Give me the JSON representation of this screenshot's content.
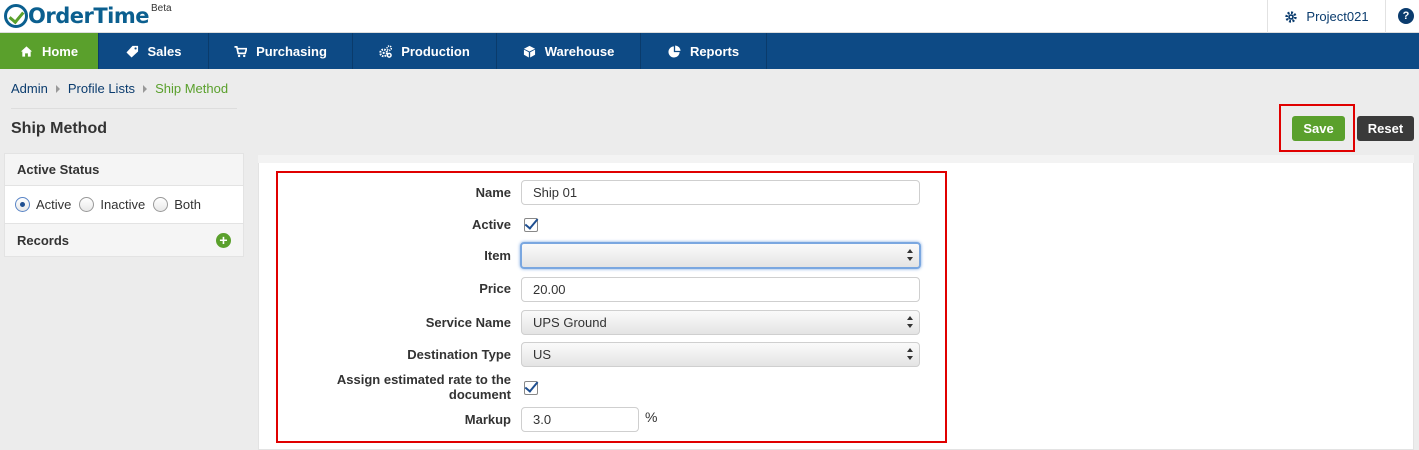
{
  "app": {
    "logo_text": "OrderTime",
    "logo_beta": "Beta",
    "project": "Project021",
    "help_glyph": "?"
  },
  "nav": [
    {
      "label": "Home",
      "icon": "home-icon",
      "active": true
    },
    {
      "label": "Sales",
      "icon": "tag-icon",
      "active": false
    },
    {
      "label": "Purchasing",
      "icon": "cart-icon",
      "active": false
    },
    {
      "label": "Production",
      "icon": "gears-icon",
      "active": false
    },
    {
      "label": "Warehouse",
      "icon": "box-icon",
      "active": false
    },
    {
      "label": "Reports",
      "icon": "pie-chart-icon",
      "active": false
    }
  ],
  "breadcrumb": [
    "Admin",
    "Profile Lists",
    "Ship Method"
  ],
  "page_title": "Ship Method",
  "toolbar": {
    "save_label": "Save",
    "reset_label": "Reset"
  },
  "sidebar": {
    "status_header": "Active Status",
    "status_options": [
      "Active",
      "Inactive",
      "Both"
    ],
    "status_selected": "Active",
    "records_header": "Records",
    "add_glyph": "+"
  },
  "form": {
    "name_label": "Name",
    "name_value": "Ship 01",
    "active_label": "Active",
    "active_checked": true,
    "item_label": "Item",
    "item_value": "",
    "price_label": "Price",
    "price_value": "20.00",
    "service_label": "Service Name",
    "service_value": "UPS Ground",
    "destination_label": "Destination Type",
    "destination_value": "US",
    "assign_label": "Assign estimated rate to the document",
    "assign_checked": true,
    "markup_label": "Markup",
    "markup_value": "3.0",
    "markup_unit": "%"
  },
  "colors": {
    "nav_bg": "#0d4a85",
    "accent_green": "#5aa02c",
    "highlight_red": "#e00000",
    "link_blue": "#0b3c6e"
  }
}
